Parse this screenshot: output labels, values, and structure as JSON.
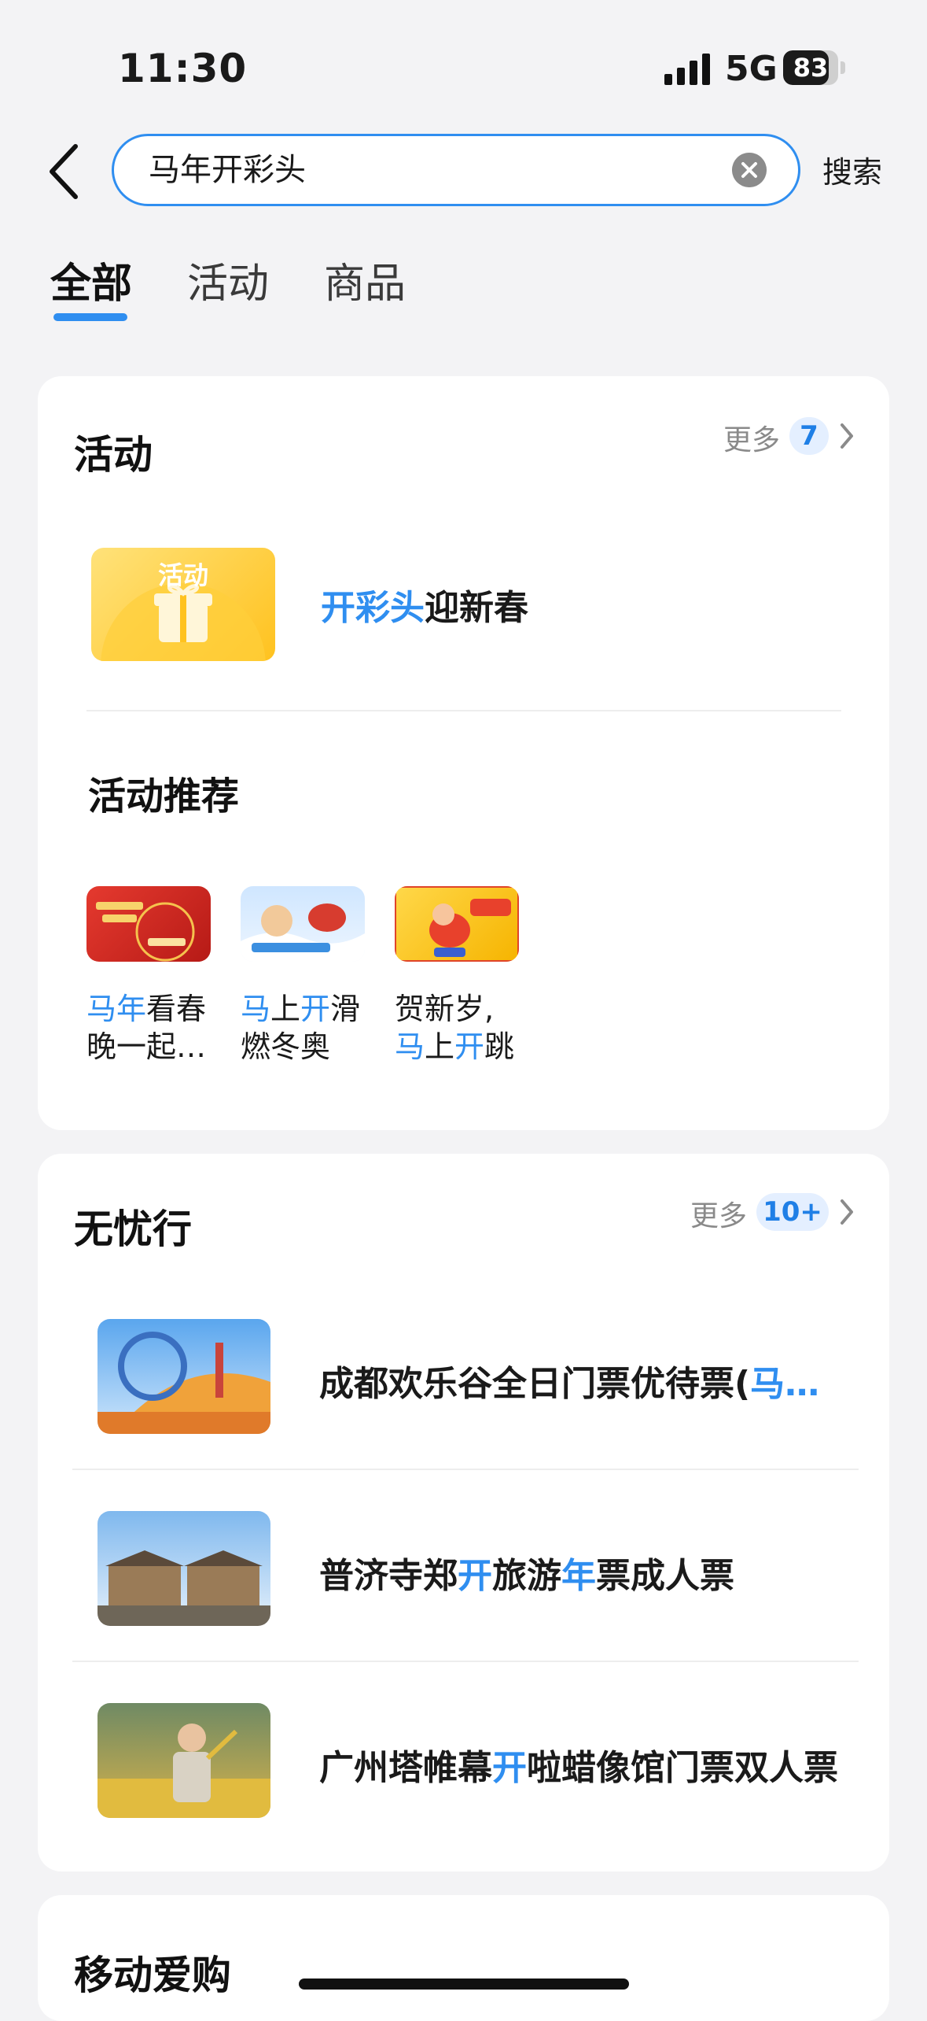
{
  "status": {
    "time": "11:30",
    "network": "5G",
    "battery": "83",
    "battery_level": 0.83
  },
  "search": {
    "query": "马年开彩头",
    "button": "搜索"
  },
  "tabs": [
    {
      "label": "全部",
      "active": true
    },
    {
      "label": "活动",
      "active": false
    },
    {
      "label": "商品",
      "active": false
    }
  ],
  "activity": {
    "title": "活动",
    "more_label": "更多",
    "count": "7",
    "featured": {
      "thumb_label": "活动",
      "title_highlight": "开彩头",
      "title_rest": "迎新春"
    },
    "recommend_title": "活动推荐",
    "recommend": [
      {
        "line1_hl": "马年",
        "line1_rest": "看春",
        "line2": "晚一起…"
      },
      {
        "l1a": "马",
        "l1b": "上",
        "l1c": "开",
        "l1d": "滑",
        "line2": "燃冬奥"
      },
      {
        "line1": "贺新岁,",
        "l2a": "马",
        "l2b": "上",
        "l2c": "开",
        "l2d": "跳"
      }
    ]
  },
  "travel": {
    "title": "无忧行",
    "more_label": "更多",
    "count": "10+",
    "items": [
      {
        "a": "成都欢乐谷全日门票优待票(",
        "b": "马…"
      },
      {
        "a": "普济寺郑",
        "b": "开",
        "c": "旅游",
        "d": "年",
        "e": "票成人票"
      },
      {
        "a": "广州塔帷幕",
        "b": "开",
        "c": "啦蜡像馆门票双人票"
      }
    ]
  },
  "shopping": {
    "title": "移动爱购"
  },
  "colors": {
    "accent": "#2f8ef0",
    "background": "#f3f3f5",
    "card": "#ffffff"
  }
}
